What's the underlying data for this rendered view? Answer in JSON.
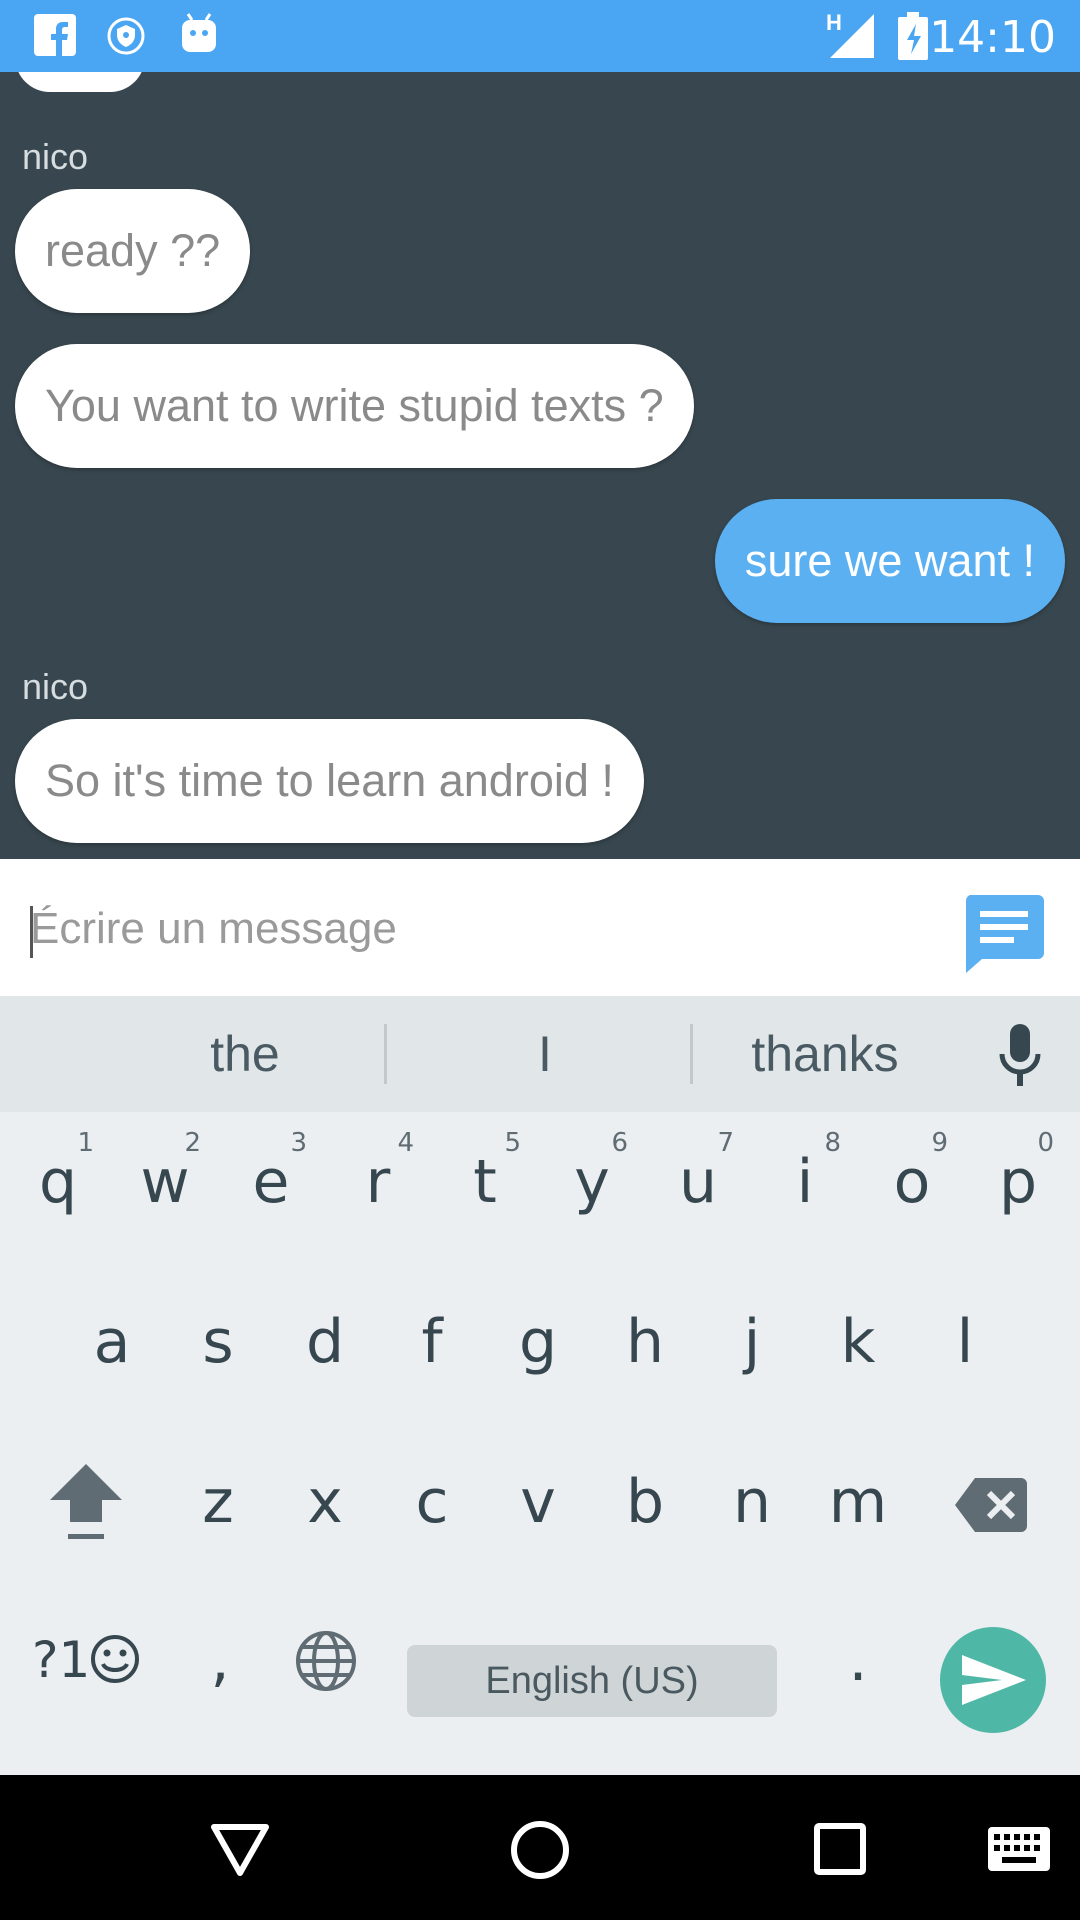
{
  "status_bar": {
    "time": "14:10",
    "network": "H",
    "icons": [
      "facebook-icon",
      "vpn-shield-icon",
      "android-debug-icon",
      "signal-icon",
      "battery-charging-icon"
    ],
    "color": "#4AA6F2"
  },
  "chat": {
    "background": "#38474F",
    "messages": [
      {
        "sender": "nico",
        "text": "ready ??",
        "direction": "incoming"
      },
      {
        "text": "You want to write stupid texts ?",
        "direction": "incoming"
      },
      {
        "text": "sure we want !",
        "direction": "outgoing"
      },
      {
        "sender": "nico",
        "text": "So it's time to learn android !",
        "direction": "incoming"
      }
    ]
  },
  "composer": {
    "placeholder": "Écrire un message",
    "send_icon": "message-icon",
    "accent": "#5BB0F2"
  },
  "keyboard": {
    "suggestions": [
      "the",
      "I",
      "thanks"
    ],
    "row1": [
      "q",
      "w",
      "e",
      "r",
      "t",
      "y",
      "u",
      "i",
      "o",
      "p"
    ],
    "row1_hints": [
      "1",
      "2",
      "3",
      "4",
      "5",
      "6",
      "7",
      "8",
      "9",
      "0"
    ],
    "row2": [
      "a",
      "s",
      "d",
      "f",
      "g",
      "h",
      "j",
      "k",
      "l"
    ],
    "row3": [
      "z",
      "x",
      "c",
      "v",
      "b",
      "n",
      "m"
    ],
    "symbols_label": "?1",
    "comma": ",",
    "period": ".",
    "space_label": "English (US)",
    "enter_color": "#4FB7A6"
  },
  "nav_bar": {
    "icons": [
      "back-icon",
      "home-icon",
      "recents-icon",
      "keyboard-switch-icon"
    ]
  }
}
